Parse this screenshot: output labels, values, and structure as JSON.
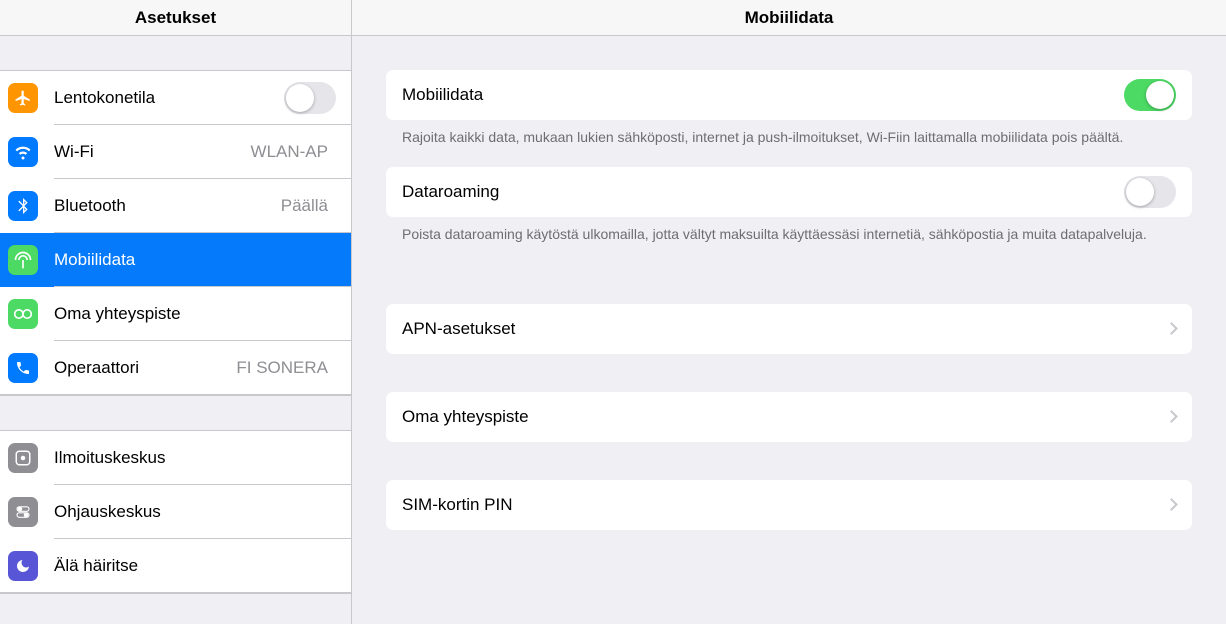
{
  "sidebar": {
    "title": "Asetukset",
    "group1": [
      {
        "label": "Lentokonetila",
        "icon": "airplane",
        "color": "#ff9500",
        "toggle": false
      },
      {
        "label": "Wi-Fi",
        "icon": "wifi",
        "color": "#007aff",
        "detail": "WLAN-AP"
      },
      {
        "label": "Bluetooth",
        "icon": "bluetooth",
        "color": "#007aff",
        "detail": "Päällä"
      },
      {
        "label": "Mobiilidata",
        "icon": "cellular",
        "color": "#4cd964",
        "selected": true
      },
      {
        "label": "Oma yhteyspiste",
        "icon": "hotspot",
        "color": "#4cd964"
      },
      {
        "label": "Operaattori",
        "icon": "phone",
        "color": "#007aff",
        "detail": "FI SONERA"
      }
    ],
    "group2": [
      {
        "label": "Ilmoituskeskus",
        "icon": "notify",
        "color": "#8e8e93"
      },
      {
        "label": "Ohjauskeskus",
        "icon": "control",
        "color": "#8e8e93"
      },
      {
        "label": "Älä häiritse",
        "icon": "moon",
        "color": "#5856d6"
      }
    ]
  },
  "main": {
    "title": "Mobiilidata",
    "cellular": {
      "label": "Mobiilidata",
      "on": true,
      "help": "Rajoita kaikki data, mukaan lukien sähköposti, internet ja push-ilmoitukset, Wi-Fiin laittamalla mobiilidata pois päältä."
    },
    "roaming": {
      "label": "Dataroaming",
      "on": false,
      "help": "Poista dataroaming käytöstä ulkomailla, jotta vältyt maksuilta käyttäessäsi internetiä, sähköpostia ja muita datapalveluja."
    },
    "links": {
      "apn": "APN-asetukset",
      "hotspot": "Oma yhteyspiste",
      "simpin": "SIM-kortin PIN"
    }
  }
}
